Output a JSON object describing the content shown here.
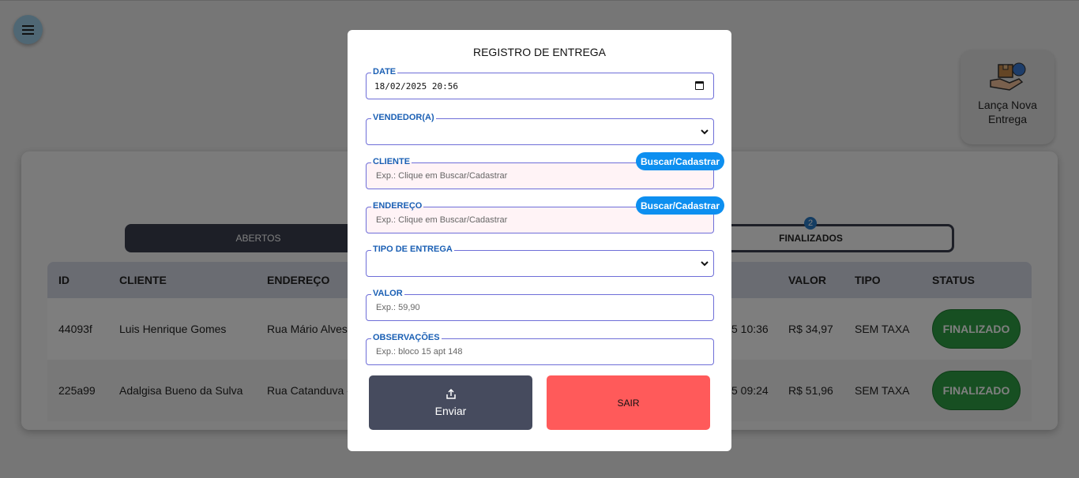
{
  "background": {
    "new_delivery": {
      "label": "Lança Nova Entrega",
      "icon": "delivery-box-hand-icon"
    },
    "tabs": [
      {
        "label": "ABERTOS"
      },
      {
        "label": "FINALIZADOS",
        "badge": "2"
      }
    ],
    "table": {
      "columns": [
        "ID",
        "CLIENTE",
        "ENDEREÇO",
        "VALOR",
        "TIPO",
        "STATUS"
      ],
      "rows": [
        {
          "id": "44093f",
          "cliente": "Luis Henrique Gomes",
          "endereco": "Rua Mário Alves",
          "hora": "5 10:36",
          "valor": "R$ 34,97",
          "tipo": "SEM TAXA",
          "status": "FINALIZADO"
        },
        {
          "id": "225a99",
          "cliente": "Adalgisa Bueno da Sulva",
          "endereco": "Rua Catanduva -",
          "hora": "5 09:24",
          "valor": "R$ 51,96",
          "tipo": "SEM TAXA",
          "status": "FINALIZADO"
        }
      ]
    }
  },
  "modal": {
    "title": "REGISTRO DE ENTREGA",
    "date": {
      "label": "DATE",
      "value": "18/02/2025 20:56"
    },
    "vendedor": {
      "label": "VENDEDOR(A)",
      "value": ""
    },
    "cliente": {
      "label": "CLIENTE",
      "placeholder": "Exp.: Clique em Buscar/Cadastrar",
      "button": "Buscar/Cadastrar"
    },
    "endereco": {
      "label": "ENDEREÇO",
      "placeholder": "Exp.: Clique em Buscar/Cadastrar",
      "button": "Buscar/Cadastrar"
    },
    "tipo_entrega": {
      "label": "TIPO DE ENTREGA",
      "value": ""
    },
    "valor": {
      "label": "VALOR",
      "placeholder": "Exp.: 59,90"
    },
    "observacoes": {
      "label": "OBSERVAÇÕES",
      "placeholder": "Exp.: bloco 15 apt 148"
    },
    "send_label": "Enviar",
    "exit_label": "SAIR"
  },
  "colors": {
    "accent": "#0d8ff0",
    "status_green": "#2f9e44",
    "exit_red": "#ff5a5a",
    "dark": "#3a3f4f"
  }
}
